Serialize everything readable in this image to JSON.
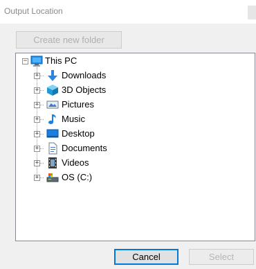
{
  "dialog": {
    "title": "Output Location",
    "create_folder_label": "Create new folder",
    "cancel_label": "Cancel",
    "select_label": "Select"
  },
  "tree": {
    "root": {
      "label": "This PC",
      "icon": "computer-icon",
      "expanded": true
    },
    "children": [
      {
        "label": "Downloads",
        "icon": "downloads-icon"
      },
      {
        "label": "3D Objects",
        "icon": "3d-objects-icon"
      },
      {
        "label": "Pictures",
        "icon": "pictures-icon"
      },
      {
        "label": "Music",
        "icon": "music-icon"
      },
      {
        "label": "Desktop",
        "icon": "desktop-icon"
      },
      {
        "label": "Documents",
        "icon": "documents-icon"
      },
      {
        "label": "Videos",
        "icon": "videos-icon"
      },
      {
        "label": "OS (C:)",
        "icon": "drive-icon"
      }
    ]
  },
  "colors": {
    "accent": "#0078d7",
    "tree_border": "#828790",
    "dialog_bg": "#f0f0f0"
  }
}
